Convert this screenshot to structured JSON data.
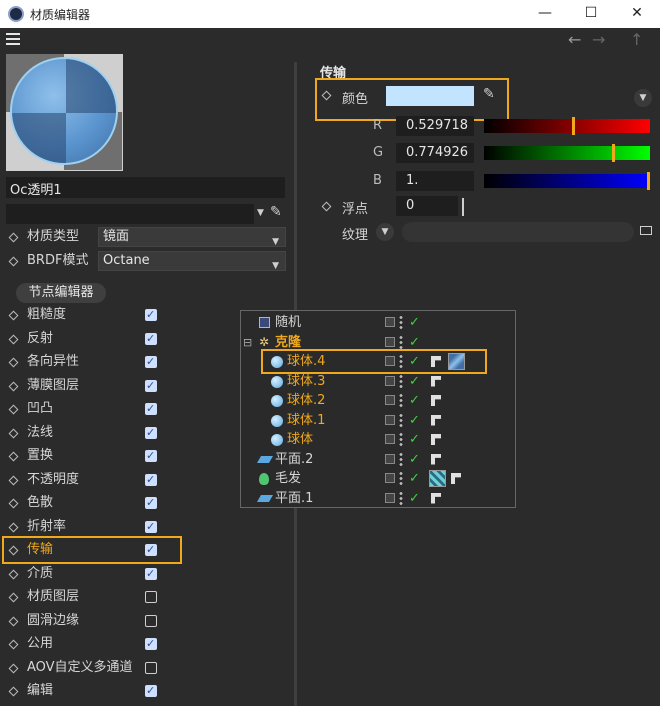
{
  "window": {
    "title": "材质编辑器",
    "minimize": "—",
    "maximize": "☐",
    "close": "✕"
  },
  "toolbar": {
    "back": "←",
    "forward": "→",
    "up": "↑"
  },
  "material": {
    "name": "Oc透明1",
    "second_field": ""
  },
  "left": {
    "material_type_label": "材质类型",
    "material_type_value": "镜面",
    "brdf_label": "BRDF模式",
    "brdf_value": "Octane",
    "node_editor_button": "节点编辑器",
    "channels": [
      {
        "label": "粗糙度",
        "checked": true
      },
      {
        "label": "反射",
        "checked": true
      },
      {
        "label": "各向异性",
        "checked": true
      },
      {
        "label": "薄膜图层",
        "checked": true
      },
      {
        "label": "凹凸",
        "checked": true
      },
      {
        "label": "法线",
        "checked": true
      },
      {
        "label": "置换",
        "checked": true
      },
      {
        "label": "不透明度",
        "checked": true
      },
      {
        "label": "色散",
        "checked": true
      },
      {
        "label": "折射率",
        "checked": true
      },
      {
        "label": "传输",
        "checked": true
      },
      {
        "label": "介质",
        "checked": true
      },
      {
        "label": "材质图层",
        "checked": false
      },
      {
        "label": "圆滑边缘",
        "checked": false
      },
      {
        "label": "公用",
        "checked": true
      },
      {
        "label": "AOV自定义多通道",
        "checked": false
      },
      {
        "label": "编辑",
        "checked": true
      }
    ]
  },
  "right": {
    "section_title": "传输",
    "color_label": "颜色",
    "swatch_color": "#c3e4ff",
    "r_label": "R",
    "r_value": "0.529718",
    "r_level": 0.53,
    "g_label": "G",
    "g_value": "0.774926",
    "g_level": 0.77,
    "b_label": "B",
    "b_value": "1.",
    "b_level": 1.0,
    "float_label": "浮点",
    "float_value": "0",
    "float_level": 0.0,
    "texture_label": "纹理"
  },
  "objects": [
    {
      "name": "随机",
      "icon": "random-effector-icon",
      "indent": 0,
      "color": "#d6d6d6",
      "expand": "",
      "bold": false
    },
    {
      "name": "克隆",
      "icon": "cloner-icon",
      "indent": 0,
      "color": "#f0a81c",
      "expand": "⊟",
      "bold": true
    },
    {
      "name": "球体.4",
      "icon": "sphere-icon",
      "indent": 1,
      "color": "#f0a81c",
      "expand": "",
      "bold": false,
      "material_thumb": true
    },
    {
      "name": "球体.3",
      "icon": "sphere-icon",
      "indent": 1,
      "color": "#f0a81c",
      "expand": "",
      "bold": false
    },
    {
      "name": "球体.2",
      "icon": "sphere-icon",
      "indent": 1,
      "color": "#f0a81c",
      "expand": "",
      "bold": false
    },
    {
      "name": "球体.1",
      "icon": "sphere-icon",
      "indent": 1,
      "color": "#f0a81c",
      "expand": "",
      "bold": false
    },
    {
      "name": "球体",
      "icon": "sphere-icon",
      "indent": 1,
      "color": "#f0a81c",
      "expand": "",
      "bold": false
    },
    {
      "name": "平面.2",
      "icon": "plane-icon",
      "indent": 0,
      "color": "#d6d6d6",
      "expand": "",
      "bold": false
    },
    {
      "name": "毛发",
      "icon": "hair-icon",
      "indent": 0,
      "color": "#d6d6d6",
      "expand": "",
      "bold": false,
      "fur_thumb": true
    },
    {
      "name": "平面.1",
      "icon": "plane-icon",
      "indent": 0,
      "color": "#d6d6d6",
      "expand": "",
      "bold": false
    }
  ]
}
